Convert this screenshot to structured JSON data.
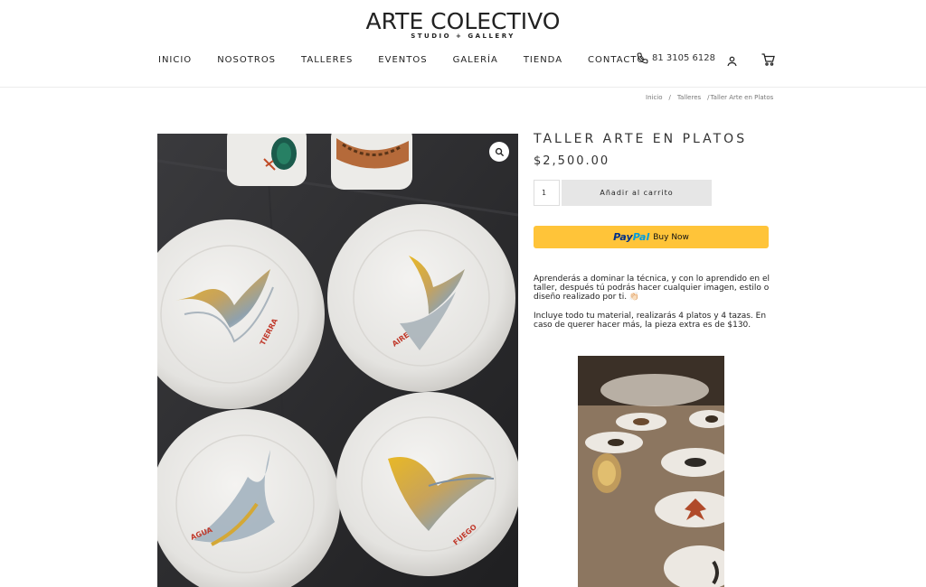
{
  "brand": {
    "name": "ARTE COLECTIVO",
    "tagline": "STUDIO + GALLERY"
  },
  "nav": {
    "items": [
      {
        "label": "INICIO"
      },
      {
        "label": "NOSOTROS"
      },
      {
        "label": "TALLERES"
      },
      {
        "label": "EVENTOS"
      },
      {
        "label": "GALERÍA"
      },
      {
        "label": "TIENDA"
      },
      {
        "label": "CONTACTO"
      }
    ],
    "phone": "81 3105 6128",
    "icons": [
      "phone-icon",
      "user-icon",
      "cart-icon"
    ]
  },
  "breadcrumb": {
    "items": [
      "Inicio",
      "Talleres",
      "Taller Arte en Platos"
    ],
    "separator": "/"
  },
  "product": {
    "title": "TALLER ARTE EN PLATOS",
    "price": "$2,500.00",
    "quantity": "1",
    "add_to_cart_label": "Añadir al carrito",
    "paypal": {
      "logo_part1": "Pay",
      "logo_part2": "Pal",
      "label": "Buy Now",
      "color": "#ffc439"
    },
    "description": [
      "Aprenderás a dominar la técnica, y con lo aprendido en el taller, después tú podrás hacer cualquier imagen, estilo o diseño realizado por ti. 👏🏻",
      "Incluye todo tu material, realizarás 4 platos y 4 tazas. En caso de querer hacer más, la pieza extra es de $130."
    ],
    "plate_words": [
      "TIERRA",
      "AIRE",
      "AGUA",
      "FUEGO"
    ],
    "zoom_icon": "magnifier-icon"
  }
}
